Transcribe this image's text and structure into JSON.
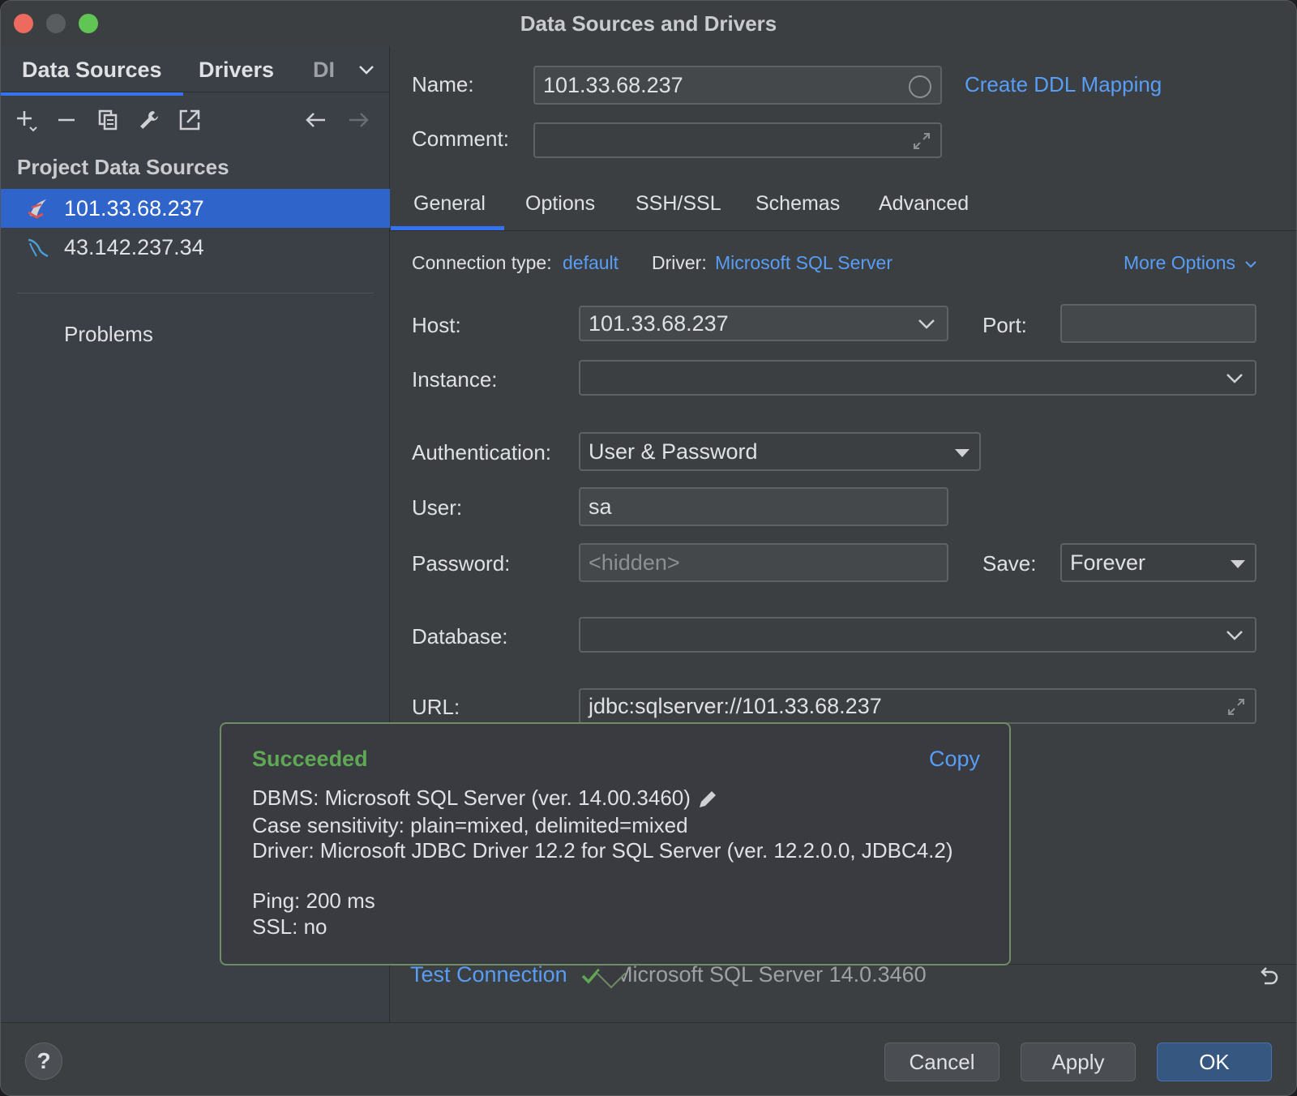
{
  "window": {
    "title": "Data Sources and Drivers"
  },
  "left": {
    "tabs": [
      "Data Sources",
      "Drivers",
      "DI"
    ],
    "section_header": "Project Data Sources",
    "items": [
      {
        "label": "101.33.68.237",
        "icon": "sql-server-icon",
        "selected": true
      },
      {
        "label": "43.142.237.34",
        "icon": "mysql-dolphin-icon",
        "selected": false
      }
    ],
    "problems_label": "Problems"
  },
  "header": {
    "name_label": "Name:",
    "name_value": "101.33.68.237",
    "comment_label": "Comment:",
    "comment_value": "",
    "ddl_link": "Create DDL Mapping"
  },
  "tabs": [
    "General",
    "Options",
    "SSH/SSL",
    "Schemas",
    "Advanced"
  ],
  "general": {
    "connection_type_label": "Connection type:",
    "connection_type_value": "default",
    "driver_label": "Driver:",
    "driver_value": "Microsoft SQL Server",
    "more_options": "More Options",
    "host_label": "Host:",
    "host_value": "101.33.68.237",
    "port_label": "Port:",
    "port_value": "",
    "instance_label": "Instance:",
    "instance_value": "",
    "auth_label": "Authentication:",
    "auth_value": "User & Password",
    "user_label": "User:",
    "user_value": "sa",
    "password_label": "Password:",
    "password_placeholder": "<hidden>",
    "save_label": "Save:",
    "save_value": "Forever",
    "database_label": "Database:",
    "database_value": "",
    "url_label": "URL:",
    "url_value": "jdbc:sqlserver://101.33.68.237"
  },
  "popup": {
    "status": "Succeeded",
    "copy": "Copy",
    "lines": [
      "DBMS: Microsoft SQL Server (ver. 14.00.3460)",
      "Case sensitivity: plain=mixed, delimited=mixed",
      "Driver: Microsoft JDBC Driver 12.2 for SQL Server (ver. 12.2.0.0, JDBC4.2)",
      "Ping: 200 ms",
      "SSL: no"
    ]
  },
  "test": {
    "button": "Test Connection",
    "result": "Microsoft SQL Server 14.0.3460"
  },
  "footer": {
    "help": "?",
    "cancel": "Cancel",
    "apply": "Apply",
    "ok": "OK"
  },
  "colors": {
    "accent": "#3574f0",
    "link": "#589df6",
    "success": "#5fa955"
  }
}
